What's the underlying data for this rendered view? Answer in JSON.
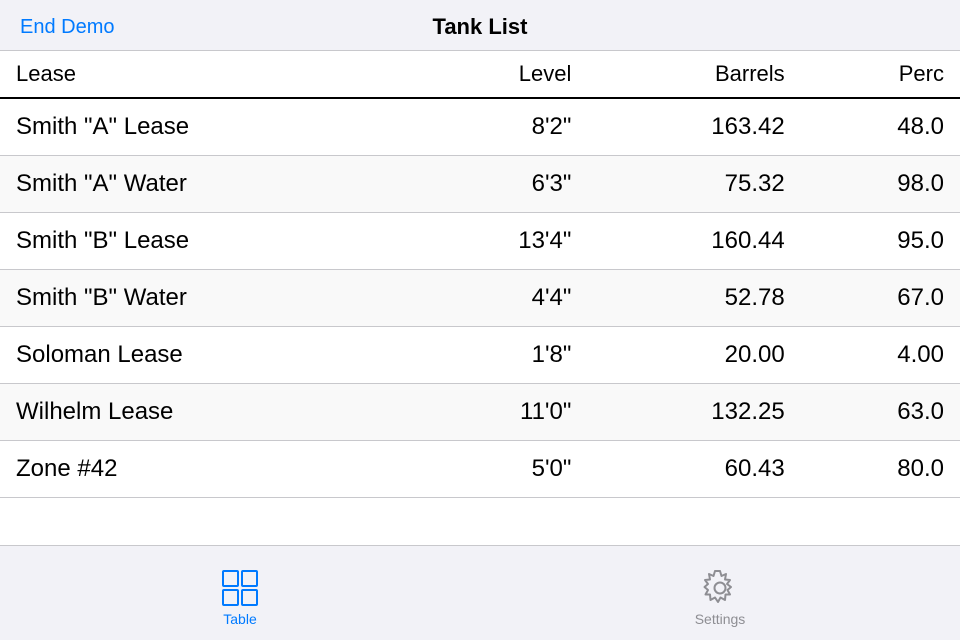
{
  "header": {
    "title": "Tank List",
    "end_demo_label": "End Demo"
  },
  "table": {
    "columns": [
      {
        "key": "lease",
        "label": "Lease",
        "align": "left"
      },
      {
        "key": "level",
        "label": "Level",
        "align": "right"
      },
      {
        "key": "barrels",
        "label": "Barrels",
        "align": "right"
      },
      {
        "key": "percent",
        "label": "Perc",
        "align": "right"
      }
    ],
    "rows": [
      {
        "lease": "Smith \"A\" Lease",
        "level": "8'2\"",
        "barrels": "163.42",
        "percent": "48.0"
      },
      {
        "lease": "Smith \"A\" Water",
        "level": "6'3\"",
        "barrels": "75.32",
        "percent": "98.0"
      },
      {
        "lease": "Smith \"B\" Lease",
        "level": "13'4\"",
        "barrels": "160.44",
        "percent": "95.0"
      },
      {
        "lease": "Smith \"B\" Water",
        "level": "4'4\"",
        "barrels": "52.78",
        "percent": "67.0"
      },
      {
        "lease": "Soloman Lease",
        "level": "1'8\"",
        "barrels": "20.00",
        "percent": "4.00"
      },
      {
        "lease": "Wilhelm Lease",
        "level": "11'0\"",
        "barrels": "132.25",
        "percent": "63.0"
      },
      {
        "lease": "Zone #42",
        "level": "5'0\"",
        "barrels": "60.43",
        "percent": "80.0"
      }
    ]
  },
  "tabs": [
    {
      "key": "table",
      "label": "Table",
      "active": true
    },
    {
      "key": "settings",
      "label": "Settings",
      "active": false
    }
  ],
  "colors": {
    "blue": "#007AFF",
    "gray": "#8e8e93"
  }
}
